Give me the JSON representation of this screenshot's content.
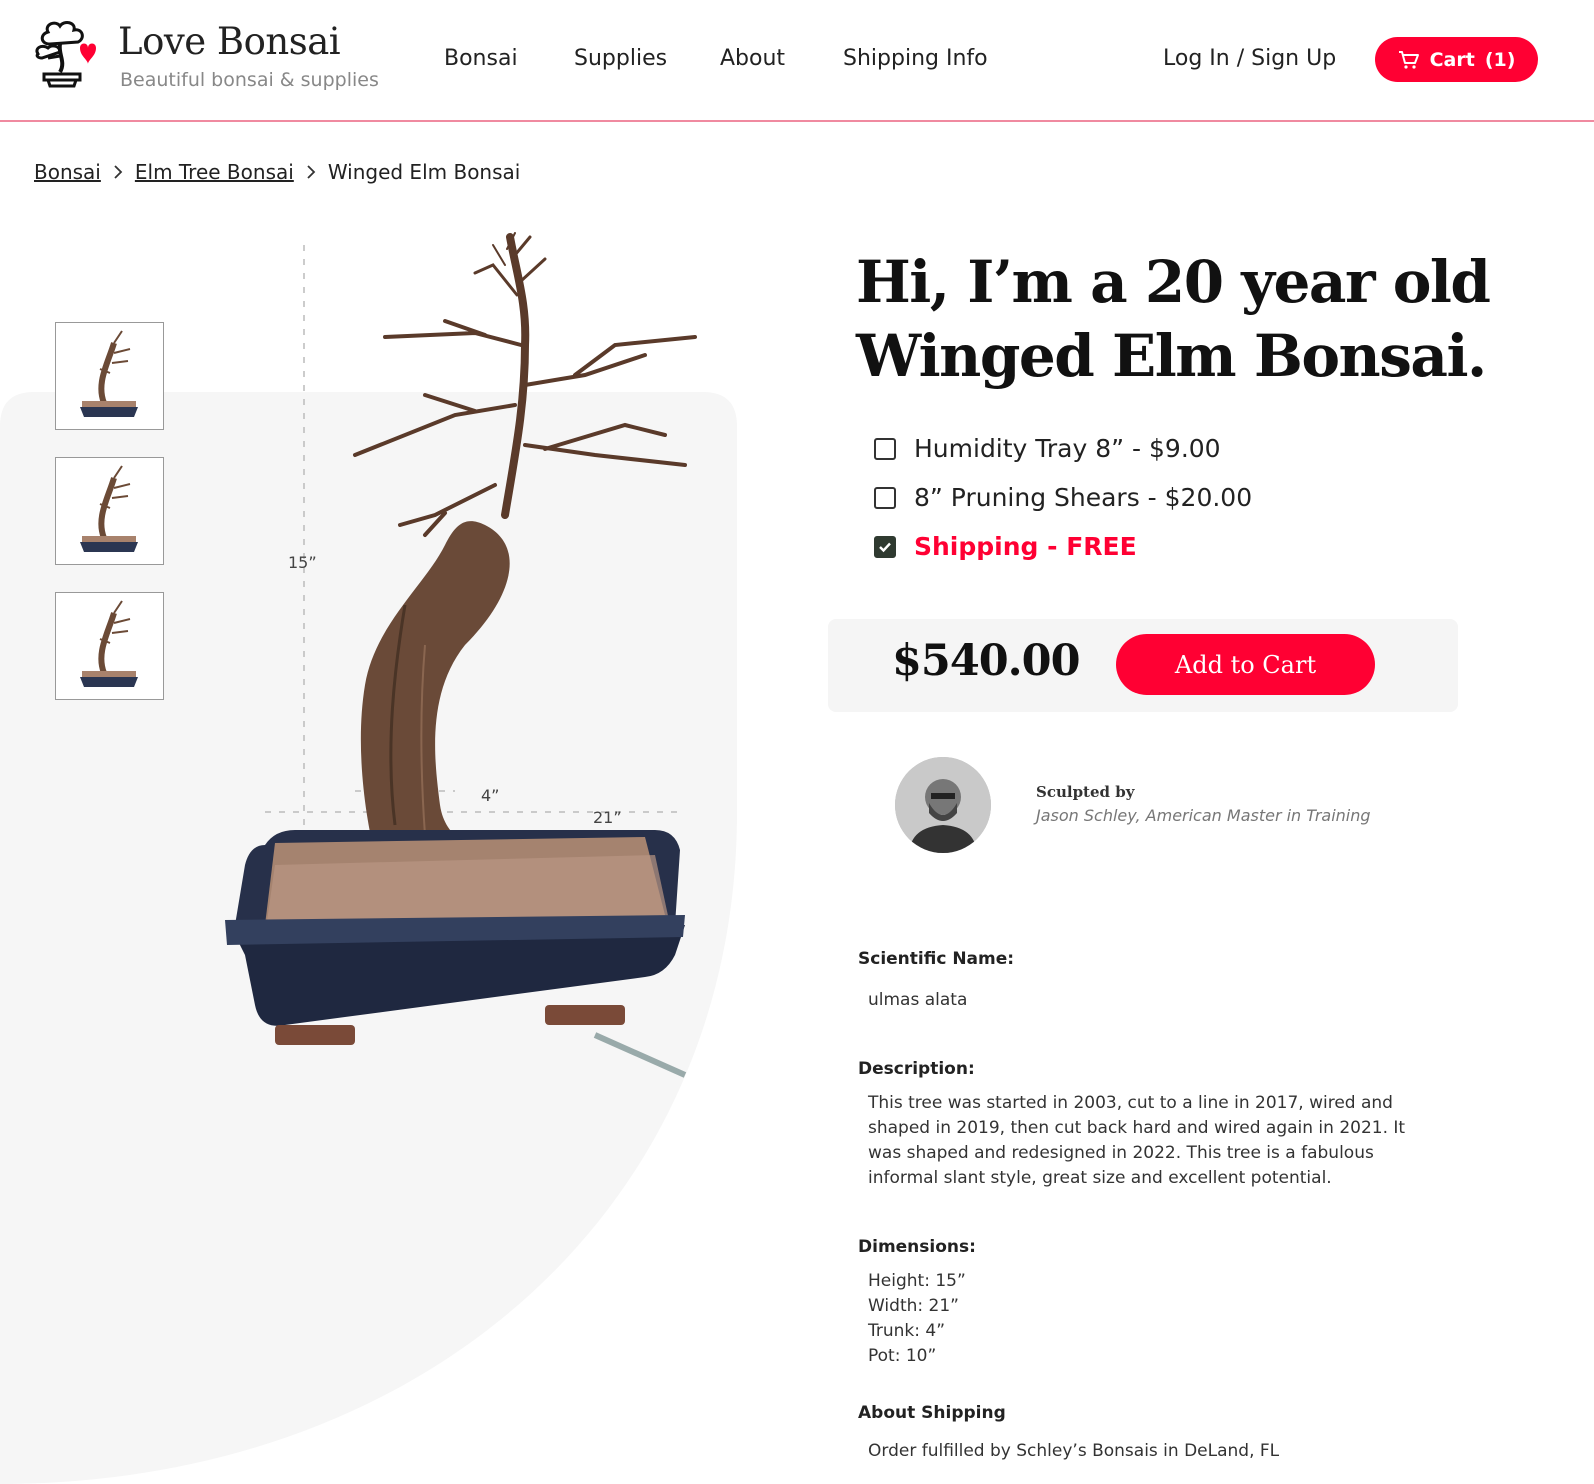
{
  "brand": {
    "name": "Love Bonsai",
    "tagline": "Beautiful bonsai & supplies"
  },
  "nav": {
    "items": [
      "Bonsai",
      "Supplies",
      "About",
      "Shipping Info"
    ],
    "login": "Log In / Sign Up",
    "cart_label": "Cart",
    "cart_count": "(1)"
  },
  "breadcrumb": {
    "items": [
      "Bonsai",
      "Elm Tree Bonsai",
      "Winged Elm Bonsai"
    ]
  },
  "dimensions_overlay": {
    "height": "15”",
    "trunk": "4”",
    "width": "21”"
  },
  "product": {
    "title_line1": "Hi, I’m a 20 year old",
    "title_line2": "Winged Elm Bonsai.",
    "options": [
      {
        "label": "Humidity Tray 8” - $9.00",
        "checked": false
      },
      {
        "label": "8” Pruning Shears - $20.00",
        "checked": false
      },
      {
        "label": "Shipping - FREE",
        "checked": true
      }
    ],
    "price": "$540.00",
    "add_to_cart": "Add to Cart"
  },
  "sculptor": {
    "label": "Sculpted by",
    "name": "Jason Schley, American Master in Training"
  },
  "details": {
    "scientific_heading": "Scientific Name:",
    "scientific_value": "ulmas alata",
    "description_heading": "Description:",
    "description_value": "This tree was started in 2003, cut to a line in 2017, wired and shaped in 2019, then cut back hard and wired again in 2021. It was shaped and redesigned in 2022. This tree is a fabulous informal slant style, great size and excellent potential.",
    "dimensions_heading": "Dimensions:",
    "dimensions": [
      "Height: 15”",
      "Width: 21”",
      "Trunk: 4”",
      "Pot: 10”"
    ],
    "shipping_heading": "About Shipping",
    "shipping_value": "Order fulfilled by Schley’s Bonsais in DeLand, FL"
  },
  "colors": {
    "accent": "#ff0033",
    "checkbox_checked": "#2f3a30",
    "panel_bg": "#f6f6f6"
  }
}
